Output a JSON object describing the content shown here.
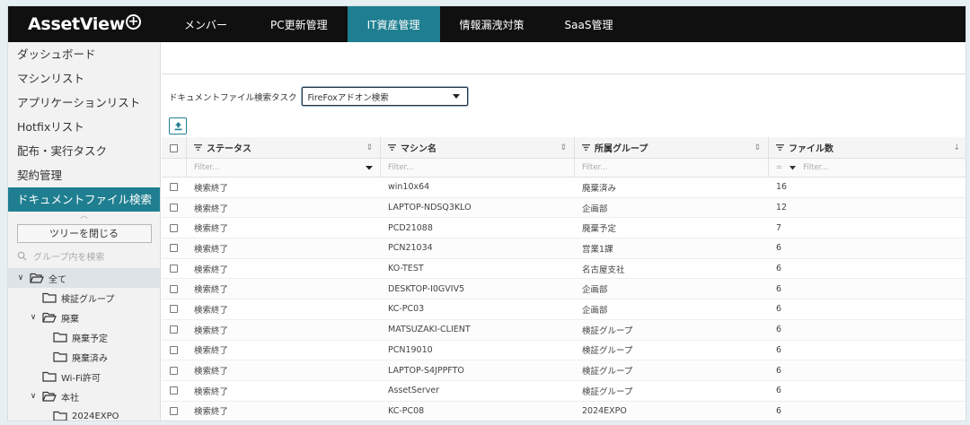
{
  "app": {
    "logo_text": "AssetView",
    "logo_plus": "+"
  },
  "nav": [
    {
      "label": "メンバー",
      "active": false
    },
    {
      "label": "PC更新管理",
      "active": false
    },
    {
      "label": "IT資産管理",
      "active": true
    },
    {
      "label": "情報漏洩対策",
      "active": false
    },
    {
      "label": "SaaS管理",
      "active": false
    }
  ],
  "sidebar": {
    "items": [
      {
        "label": "ダッシュボード"
      },
      {
        "label": "マシンリスト"
      },
      {
        "label": "アプリケーションリスト"
      },
      {
        "label": "Hotfixリスト"
      },
      {
        "label": "配布・実行タスク"
      },
      {
        "label": "契約管理"
      },
      {
        "label": "ドキュメントファイル検索"
      }
    ],
    "active_index": 6,
    "tree_button": "ツリーを閉じる",
    "search_placeholder": "グループ内を検索",
    "tree": [
      {
        "label": "全て",
        "level": 0,
        "chevron": "expanded",
        "open": true,
        "selected": true
      },
      {
        "label": "検証グループ",
        "level": 1,
        "chevron": "none",
        "open": false
      },
      {
        "label": "廃棄",
        "level": 1,
        "chevron": "expanded",
        "open": true
      },
      {
        "label": "廃棄予定",
        "level": 2,
        "chevron": "none",
        "open": false
      },
      {
        "label": "廃棄済み",
        "level": 2,
        "chevron": "none",
        "open": false
      },
      {
        "label": "Wi-Fi許可",
        "level": 1,
        "chevron": "none",
        "open": false
      },
      {
        "label": "本社",
        "level": 1,
        "chevron": "expanded",
        "open": true
      },
      {
        "label": "2024EXPO",
        "level": 2,
        "chevron": "none",
        "open": false
      }
    ]
  },
  "main": {
    "task_label": "ドキュメントファイル検索タスク",
    "task_selected": "FireFoxアドオン検索",
    "columns": [
      {
        "label": "ステータス",
        "sort": "⇕",
        "filter_placeholder": "Filter...",
        "filter_type": "select"
      },
      {
        "label": "マシン名",
        "sort": "⇕",
        "filter_placeholder": "Filter...",
        "filter_type": "text"
      },
      {
        "label": "所属グループ",
        "sort": "⇕",
        "filter_placeholder": "Filter...",
        "filter_type": "text"
      },
      {
        "label": "ファイル数",
        "sort": "↓",
        "filter_placeholder": "Filter...",
        "filter_type": "number",
        "filter_operator": "="
      }
    ],
    "rows": [
      {
        "status": "検索終了",
        "machine": "win10x64",
        "group": "廃棄済み",
        "count": "16"
      },
      {
        "status": "検索終了",
        "machine": "LAPTOP-NDSQ3KLO",
        "group": "企画部",
        "count": "12"
      },
      {
        "status": "検索終了",
        "machine": "PCD21088",
        "group": "廃棄予定",
        "count": "7"
      },
      {
        "status": "検索終了",
        "machine": "PCN21034",
        "group": "営業1課",
        "count": "6"
      },
      {
        "status": "検索終了",
        "machine": "KO-TEST",
        "group": "名古屋支社",
        "count": "6"
      },
      {
        "status": "検索終了",
        "machine": "DESKTOP-I0GVIV5",
        "group": "企画部",
        "count": "6"
      },
      {
        "status": "検索終了",
        "machine": "KC-PC03",
        "group": "企画部",
        "count": "6"
      },
      {
        "status": "検索終了",
        "machine": "MATSUZAKI-CLIENT",
        "group": "検証グループ",
        "count": "6"
      },
      {
        "status": "検索終了",
        "machine": "PCN19010",
        "group": "検証グループ",
        "count": "6"
      },
      {
        "status": "検索終了",
        "machine": "LAPTOP-S4JPPFTO",
        "group": "検証グループ",
        "count": "6"
      },
      {
        "status": "検索終了",
        "machine": "AssetServer",
        "group": "検証グループ",
        "count": "6"
      },
      {
        "status": "検索終了",
        "machine": "KC-PC08",
        "group": "2024EXPO",
        "count": "6"
      }
    ]
  },
  "colors": {
    "accent": "#1f7f91",
    "topbar": "#101010",
    "sidebar_bg": "#f2f2f2"
  }
}
